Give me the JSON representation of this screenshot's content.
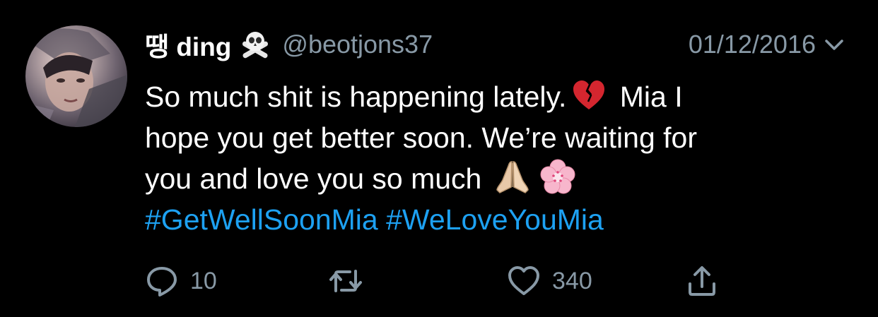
{
  "user": {
    "display_name": "땡 ding",
    "handle": "@beotjons37",
    "name_emoji": "skull-and-crossbones-icon"
  },
  "tweet": {
    "date": "01/12/2016",
    "lines": [
      [
        "So much shit is happening lately.",
        "Mia I"
      ],
      [
        "hope you get better soon. We’re waiting for"
      ],
      [
        "you and love you so much"
      ]
    ],
    "hashtags": [
      "#GetWellSoonMia",
      "#WeLoveYouMia"
    ],
    "emojis": [
      "broken-heart-icon",
      "folded-hands-icon",
      "cherry-blossom-icon"
    ]
  },
  "actions": {
    "reply_count": "10",
    "retweet_count": "",
    "like_count": "340"
  },
  "colors": {
    "background": "#000000",
    "text": "#ffffff",
    "secondary": "#8899a6",
    "link": "#1da1f2"
  }
}
